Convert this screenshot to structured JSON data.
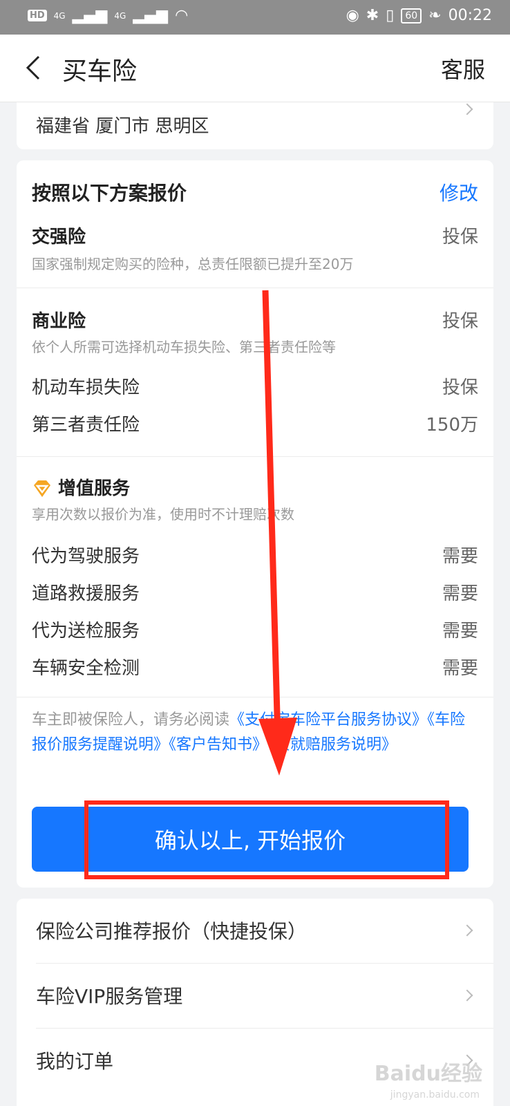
{
  "status_bar": {
    "hd": "HD",
    "net1": "4G",
    "net2": "4G",
    "battery": "60",
    "time": "00:22"
  },
  "nav": {
    "title": "买车险",
    "service": "客服"
  },
  "location": {
    "text": "福建省 厦门市 思明区"
  },
  "plan": {
    "title": "按照以下方案报价",
    "edit": "修改",
    "compulsory": {
      "label": "交强险",
      "value": "投保",
      "desc": "国家强制规定购买的险种，总责任限额已提升至20万"
    },
    "commercial": {
      "label": "商业险",
      "value": "投保",
      "desc": "依个人所需可选择机动车损失险、第三者责任险等",
      "items": [
        {
          "label": "机动车损失险",
          "value": "投保"
        },
        {
          "label": "第三者责任险",
          "value": "150万"
        }
      ]
    },
    "value_added": {
      "label": "增值服务",
      "desc": "享用次数以报价为准，使用时不计理赔次数",
      "items": [
        {
          "label": "代为驾驶服务",
          "value": "需要"
        },
        {
          "label": "道路救援服务",
          "value": "需要"
        },
        {
          "label": "代为送检服务",
          "value": "需要"
        },
        {
          "label": "车辆安全检测",
          "value": "需要"
        }
      ]
    },
    "agreement": {
      "prefix": "车主即被保险人，请务必阅读",
      "link1": "《支付宝车险平台服务协议》",
      "link2": "《车险报价服务提醒说明》",
      "link3": "《客户告知书》",
      "link4": "《贵就赔服务说明》"
    },
    "confirm_button": "确认以上, 开始报价"
  },
  "links": [
    {
      "label": "保险公司推荐报价（快捷投保）"
    },
    {
      "label": "车险VIP服务管理"
    },
    {
      "label": "我的订单"
    }
  ],
  "watermark": {
    "main": "Baidu经验",
    "sub": "jingyan.baidu.com"
  },
  "colors": {
    "accent": "#1677ff",
    "highlight": "#ff2a1a"
  }
}
